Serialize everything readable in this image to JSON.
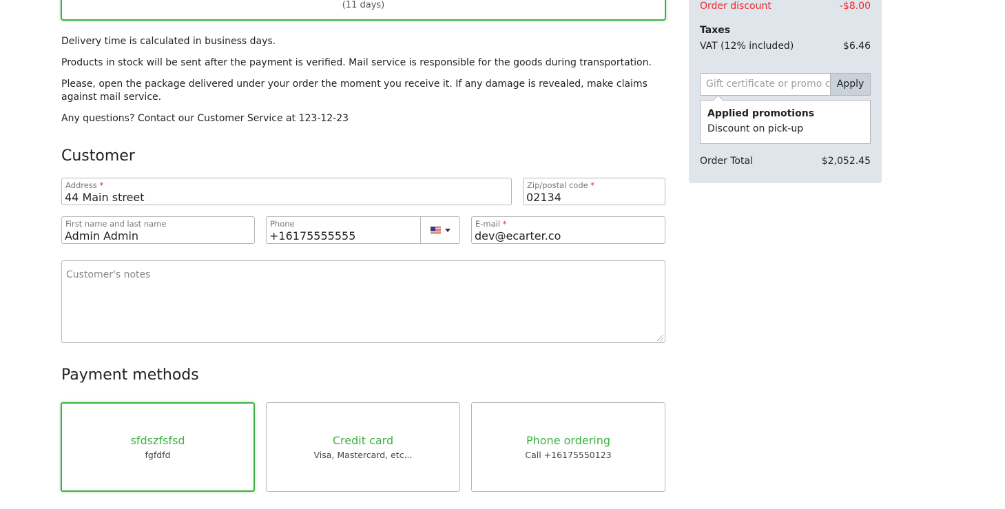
{
  "shipping": {
    "days": "(11 days)"
  },
  "info": {
    "line1": "Delivery time is calculated in business days.",
    "line2": "Products in stock will be sent after the payment is verified. Mail service is responsible for the goods during transportation.",
    "line3": "Please, open the package delivered under your order the moment you receive it. If any damage is revealed, make claims against mail service.",
    "line4": "Any questions? Contact our Customer Service at 123-12-23"
  },
  "customer": {
    "title": "Customer",
    "address": {
      "label": "Address",
      "required": "*",
      "value": "44 Main street"
    },
    "zip": {
      "label": "Zip/postal code",
      "required": "*",
      "value": "02134"
    },
    "name": {
      "label": "First name and last name",
      "value": "Admin Admin"
    },
    "phone": {
      "label": "Phone",
      "value": "+16175555555",
      "flag_icon": "us-flag-icon"
    },
    "email": {
      "label": "E-mail",
      "required": "*",
      "value": "dev@ecarter.co"
    },
    "notes_placeholder": "Customer's notes"
  },
  "payment": {
    "title": "Payment methods",
    "methods": [
      {
        "title": "sfdszfsfsd",
        "subtitle": "fgfdfd",
        "selected": true
      },
      {
        "title": "Credit card",
        "subtitle": "Visa, Mastercard, etc...",
        "selected": false
      },
      {
        "title": "Phone ordering",
        "subtitle": "Call +16175550123",
        "selected": false
      }
    ]
  },
  "summary": {
    "order_discount_label": "Order discount",
    "order_discount_value": "-$8.00",
    "taxes_title": "Taxes",
    "vat_label": "VAT (12% included)",
    "vat_value": "$6.46",
    "promo_placeholder": "Gift certificate or promo code",
    "apply_label": "Apply",
    "applied_promotions_title": "Applied promotions",
    "applied_promotions_item": "Discount on pick-up",
    "order_total_label": "Order Total",
    "order_total_value": "$2,052.45"
  },
  "colors": {
    "accent_green": "#3cb043",
    "discount_red": "#e8272c",
    "sidebar_bg": "#e0e5ec"
  }
}
